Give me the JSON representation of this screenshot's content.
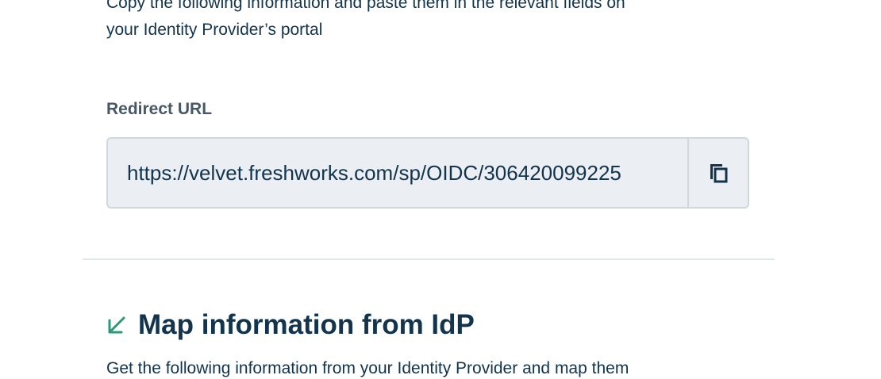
{
  "intro": {
    "line1": "Copy the following information and paste them in the relevant fields on",
    "line2": "your Identity Provider’s portal"
  },
  "redirect": {
    "label": "Redirect URL",
    "value": "https://velvet.freshworks.com/sp/OIDC/306420099225",
    "copy_icon": "copy-icon"
  },
  "map_section": {
    "icon": "arrow-down-left-icon",
    "accent_color": "#2c9a77",
    "title": "Map information from IdP",
    "description": "Get the following information from your Identity Provider and map them"
  }
}
